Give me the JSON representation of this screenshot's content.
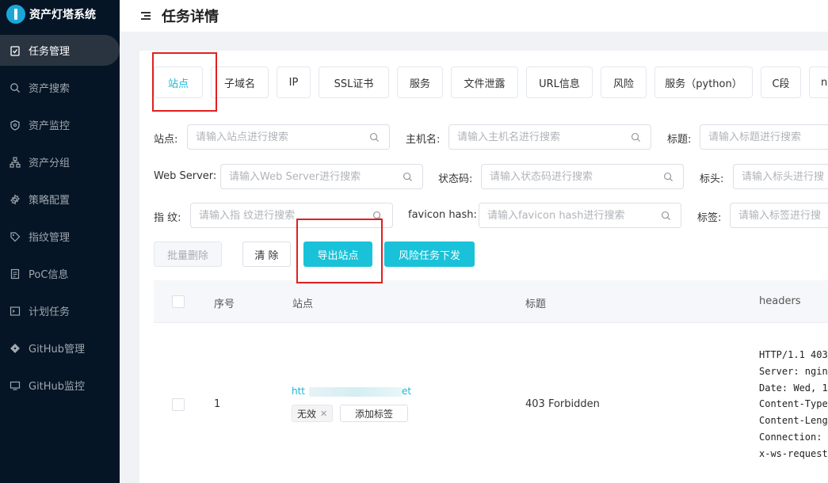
{
  "app": {
    "name": "资产灯塔系统"
  },
  "sidebar": {
    "items": [
      {
        "label": "任务管理",
        "icon": "clipboard-check-icon",
        "active": true
      },
      {
        "label": "资产搜索",
        "icon": "search-icon"
      },
      {
        "label": "资产监控",
        "icon": "shield-icon"
      },
      {
        "label": "资产分组",
        "icon": "hierarchy-icon"
      },
      {
        "label": "策略配置",
        "icon": "settings-icon"
      },
      {
        "label": "指纹管理",
        "icon": "tag-icon"
      },
      {
        "label": "PoC信息",
        "icon": "document-icon"
      },
      {
        "label": "计划任务",
        "icon": "terminal-icon"
      },
      {
        "label": "GitHub管理",
        "icon": "git-icon"
      },
      {
        "label": "GitHub监控",
        "icon": "monitor-icon"
      }
    ]
  },
  "header": {
    "title": "任务详情"
  },
  "tabs": [
    {
      "label": "站点",
      "active": true
    },
    {
      "label": "子域名"
    },
    {
      "label": "IP"
    },
    {
      "label": "SSL证书"
    },
    {
      "label": "服务"
    },
    {
      "label": "文件泄露"
    },
    {
      "label": "URL信息"
    },
    {
      "label": "风险"
    },
    {
      "label": "服务（python）"
    },
    {
      "label": "C段"
    },
    {
      "label": "nu"
    }
  ],
  "filters": {
    "site": {
      "label": "站点:",
      "placeholder": "请输入站点进行搜索"
    },
    "hostname": {
      "label": "主机名:",
      "placeholder": "请输入主机名进行搜索"
    },
    "title": {
      "label": "标题:",
      "placeholder": "请输入标题进行搜索"
    },
    "webserver": {
      "label": "Web Server:",
      "placeholder": "请输入Web Server进行搜索"
    },
    "status": {
      "label": "状态码:",
      "placeholder": "请输入状态码进行搜索"
    },
    "header": {
      "label": "标头:",
      "placeholder": "请输入标头进行搜"
    },
    "fingerprint": {
      "label": "指 纹:",
      "placeholder": "请输入指 纹进行搜索"
    },
    "favicon": {
      "label": "favicon hash:",
      "placeholder": "请输入favicon hash进行搜索"
    },
    "tags": {
      "label": "标签:",
      "placeholder": "请输入标签进行搜"
    }
  },
  "buttons": {
    "batch_delete": "批量删除",
    "clear": "清 除",
    "export_sites": "导出站点",
    "risk_task": "风险任务下发"
  },
  "table": {
    "columns": [
      "序号",
      "站点",
      "标题",
      "headers"
    ],
    "rows": [
      {
        "index": "1",
        "site_prefix": "htt",
        "site_suffix": "et",
        "tag": "无效",
        "add_tag": "添加标签",
        "title": "403 Forbidden",
        "headers": "HTTP/1.1 403\nServer: ngin\nDate: Wed, 1\nContent-Type\nContent-Leng\nConnection: \nx-ws-request"
      }
    ]
  },
  "colors": {
    "accent": "#19c2d8",
    "sidebar_bg": "#051526",
    "highlight": "#e02020"
  }
}
